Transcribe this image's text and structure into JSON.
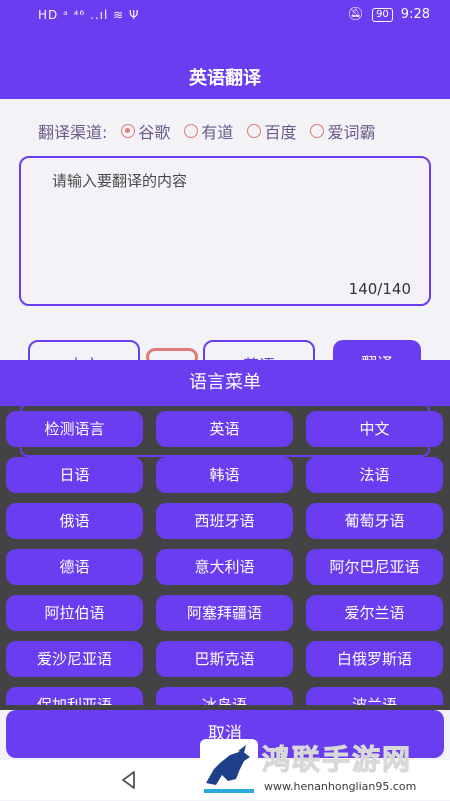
{
  "status_bar": {
    "left": "HD ᵃ  ⁴⁶ ..ıl  ≋  Ψ",
    "battery": "90",
    "time": "9:28"
  },
  "header": {
    "title": "英语翻译"
  },
  "channel": {
    "label": "翻译渠道:",
    "options": [
      {
        "label": "谷歌",
        "selected": true
      },
      {
        "label": "有道",
        "selected": false
      },
      {
        "label": "百度",
        "selected": false
      },
      {
        "label": "爱词霸",
        "selected": false
      }
    ]
  },
  "input": {
    "placeholder": "请输入要翻译的内容",
    "counter": "140/140"
  },
  "background_row": {
    "source_lang": "中文",
    "target_lang": "英语",
    "translate": "翻译"
  },
  "menu": {
    "title": "语言菜单",
    "languages": [
      "检测语言",
      "英语",
      "中文",
      "日语",
      "韩语",
      "法语",
      "俄语",
      "西班牙语",
      "葡萄牙语",
      "德语",
      "意大利语",
      "阿尔巴尼亚语",
      "阿拉伯语",
      "阿塞拜疆语",
      "爱尔兰语",
      "爱沙尼亚语",
      "巴斯克语",
      "白俄罗斯语",
      "保加利亚语",
      "冰岛语",
      "波兰语"
    ],
    "cancel": "取消"
  },
  "watermark": {
    "title": "鸿联手游网",
    "url": "www.henanhonglian95.com"
  },
  "colors": {
    "primary": "#6a3df0",
    "accent": "#e07b78",
    "sheet_bg": "#434244"
  }
}
